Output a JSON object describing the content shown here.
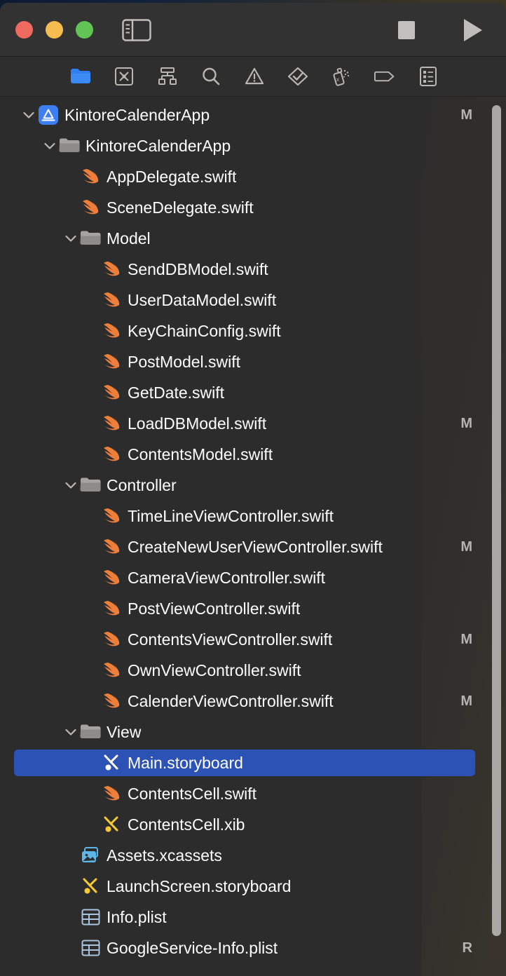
{
  "window": {
    "traffic_lights": [
      {
        "name": "close",
        "color": "#ee6a5f"
      },
      {
        "name": "minimize",
        "color": "#f5bd4f"
      },
      {
        "name": "zoom",
        "color": "#61c454"
      }
    ],
    "sidebar_toggle_label": "Toggle Navigator",
    "stop_label": "Stop",
    "run_label": "Run"
  },
  "navigator_toolbar": {
    "active_index": 0,
    "tabs": [
      {
        "icon": "folder-icon",
        "label": "Project Navigator",
        "active": true
      },
      {
        "icon": "source-control-icon",
        "label": "Source Control Navigator",
        "active": false
      },
      {
        "icon": "symbol-hierarchy-icon",
        "label": "Symbol Navigator",
        "active": false
      },
      {
        "icon": "search-icon",
        "label": "Find Navigator",
        "active": false
      },
      {
        "icon": "warning-triangle-icon",
        "label": "Issue Navigator",
        "active": false
      },
      {
        "icon": "test-diamond-icon",
        "label": "Test Navigator",
        "active": false
      },
      {
        "icon": "debug-spray-icon",
        "label": "Debug Navigator",
        "active": false
      },
      {
        "icon": "breakpoint-tag-icon",
        "label": "Breakpoint Navigator",
        "active": false
      },
      {
        "icon": "report-list-icon",
        "label": "Report Navigator",
        "active": false
      }
    ]
  },
  "colors": {
    "selection": "#2b52b4",
    "background": "#2d2c2c",
    "swift_orange": "#ef7e3a",
    "storyboard_yellow": "#f7cb2e",
    "plist_blue": "#a8c4de",
    "assets_blue": "#5cb7e8",
    "project_blue": "#3d7ff2"
  },
  "tree": [
    {
      "label": "KintoreCalenderApp",
      "icon": "xcode-project-icon",
      "depth": 0,
      "twisty": "down",
      "badge": "M",
      "selected": false
    },
    {
      "label": "KintoreCalenderApp",
      "icon": "folder-group-icon",
      "depth": 1,
      "twisty": "down",
      "badge": "",
      "selected": false
    },
    {
      "label": "AppDelegate.swift",
      "icon": "swift-file-icon",
      "depth": 2,
      "twisty": "none",
      "badge": "",
      "selected": false
    },
    {
      "label": "SceneDelegate.swift",
      "icon": "swift-file-icon",
      "depth": 2,
      "twisty": "none",
      "badge": "",
      "selected": false
    },
    {
      "label": "Model",
      "icon": "folder-group-icon",
      "depth": 2,
      "twisty": "down",
      "badge": "",
      "selected": false
    },
    {
      "label": "SendDBModel.swift",
      "icon": "swift-file-icon",
      "depth": 3,
      "twisty": "none",
      "badge": "",
      "selected": false
    },
    {
      "label": "UserDataModel.swift",
      "icon": "swift-file-icon",
      "depth": 3,
      "twisty": "none",
      "badge": "",
      "selected": false
    },
    {
      "label": "KeyChainConfig.swift",
      "icon": "swift-file-icon",
      "depth": 3,
      "twisty": "none",
      "badge": "",
      "selected": false
    },
    {
      "label": "PostModel.swift",
      "icon": "swift-file-icon",
      "depth": 3,
      "twisty": "none",
      "badge": "",
      "selected": false
    },
    {
      "label": "GetDate.swift",
      "icon": "swift-file-icon",
      "depth": 3,
      "twisty": "none",
      "badge": "",
      "selected": false
    },
    {
      "label": "LoadDBModel.swift",
      "icon": "swift-file-icon",
      "depth": 3,
      "twisty": "none",
      "badge": "M",
      "selected": false
    },
    {
      "label": "ContentsModel.swift",
      "icon": "swift-file-icon",
      "depth": 3,
      "twisty": "none",
      "badge": "",
      "selected": false
    },
    {
      "label": "Controller",
      "icon": "folder-group-icon",
      "depth": 2,
      "twisty": "down",
      "badge": "",
      "selected": false
    },
    {
      "label": "TimeLineViewController.swift",
      "icon": "swift-file-icon",
      "depth": 3,
      "twisty": "none",
      "badge": "",
      "selected": false
    },
    {
      "label": "CreateNewUserViewController.swift",
      "icon": "swift-file-icon",
      "depth": 3,
      "twisty": "none",
      "badge": "M",
      "selected": false
    },
    {
      "label": "CameraViewController.swift",
      "icon": "swift-file-icon",
      "depth": 3,
      "twisty": "none",
      "badge": "",
      "selected": false
    },
    {
      "label": "PostViewController.swift",
      "icon": "swift-file-icon",
      "depth": 3,
      "twisty": "none",
      "badge": "",
      "selected": false
    },
    {
      "label": "ContentsViewController.swift",
      "icon": "swift-file-icon",
      "depth": 3,
      "twisty": "none",
      "badge": "M",
      "selected": false
    },
    {
      "label": "OwnViewController.swift",
      "icon": "swift-file-icon",
      "depth": 3,
      "twisty": "none",
      "badge": "",
      "selected": false
    },
    {
      "label": "CalenderViewController.swift",
      "icon": "swift-file-icon",
      "depth": 3,
      "twisty": "none",
      "badge": "M",
      "selected": false
    },
    {
      "label": "View",
      "icon": "folder-group-icon",
      "depth": 2,
      "twisty": "down",
      "badge": "",
      "selected": false
    },
    {
      "label": "Main.storyboard",
      "icon": "storyboard-white-icon",
      "depth": 3,
      "twisty": "none",
      "badge": "",
      "selected": true
    },
    {
      "label": "ContentsCell.swift",
      "icon": "swift-file-icon",
      "depth": 3,
      "twisty": "none",
      "badge": "",
      "selected": false
    },
    {
      "label": "ContentsCell.xib",
      "icon": "storyboard-icon",
      "depth": 3,
      "twisty": "none",
      "badge": "",
      "selected": false
    },
    {
      "label": "Assets.xcassets",
      "icon": "assets-icon",
      "depth": 2,
      "twisty": "none",
      "badge": "",
      "selected": false
    },
    {
      "label": "LaunchScreen.storyboard",
      "icon": "storyboard-icon",
      "depth": 2,
      "twisty": "none",
      "badge": "",
      "selected": false
    },
    {
      "label": "Info.plist",
      "icon": "plist-icon",
      "depth": 2,
      "twisty": "none",
      "badge": "",
      "selected": false
    },
    {
      "label": "GoogleService-Info.plist",
      "icon": "plist-icon",
      "depth": 2,
      "twisty": "none",
      "badge": "R",
      "selected": false
    }
  ],
  "scrollbar": {
    "name": "vertical-scrollbar"
  }
}
